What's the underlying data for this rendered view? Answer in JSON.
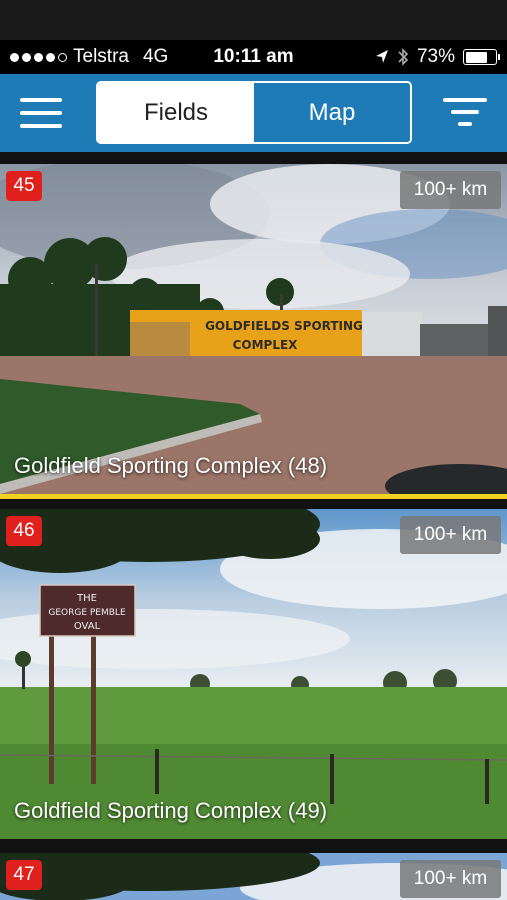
{
  "status": {
    "carrier": "Telstra",
    "network": "4G",
    "time": "10:11 am",
    "battery": "73%",
    "battery_level": 0.73
  },
  "nav": {
    "tabs": [
      {
        "label": "Fields",
        "active": true
      },
      {
        "label": "Map",
        "active": false
      }
    ]
  },
  "cards": [
    {
      "number": "45",
      "distance": "100+ km",
      "title": "Goldfield Sporting Complex (48)",
      "sign": [
        "GOLDFIELDS SPORTING",
        "COMPLEX"
      ]
    },
    {
      "number": "46",
      "distance": "100+ km",
      "title": "Goldfield Sporting Complex (49)",
      "sign": [
        "THE",
        "GEORGE PEMBLE",
        "OVAL"
      ]
    },
    {
      "number": "47",
      "distance": "100+ km",
      "title": ""
    }
  ],
  "colors": {
    "nav_bg": "#1f7bb5",
    "badge": "#e0201c",
    "highlight_line": "#f0d020"
  }
}
